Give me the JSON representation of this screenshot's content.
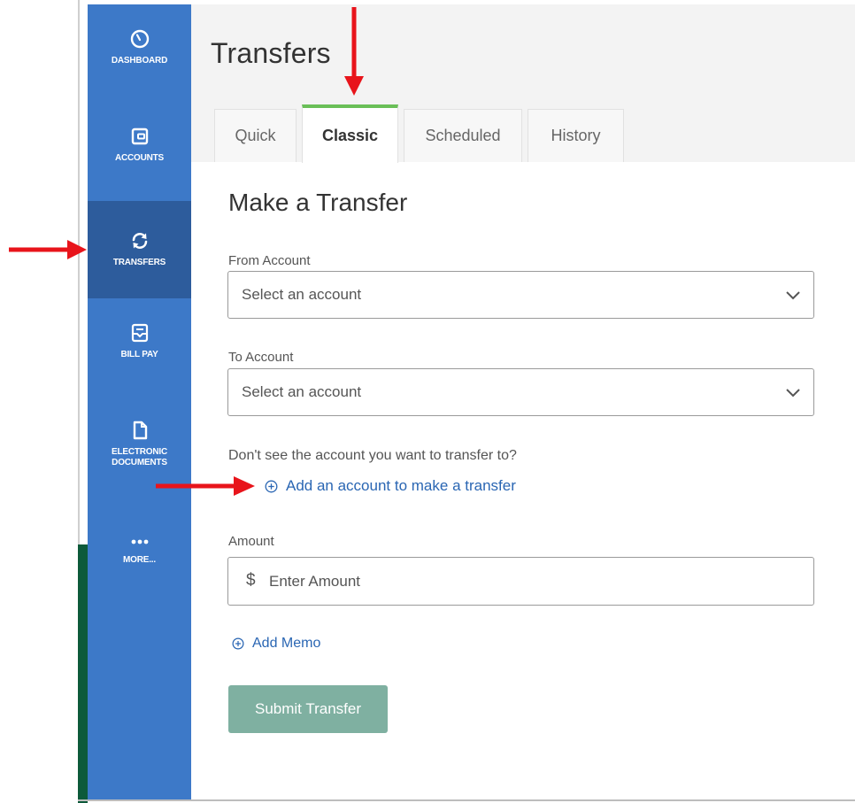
{
  "sidebar": {
    "items": [
      {
        "label": "DASHBOARD",
        "icon": "gauge-icon"
      },
      {
        "label": "ACCOUNTS",
        "icon": "wallet-icon"
      },
      {
        "label": "TRANSFERS",
        "icon": "sync-icon"
      },
      {
        "label": "BILL PAY",
        "icon": "inbox-icon"
      },
      {
        "label": "ELECTRONIC DOCUMENTS",
        "icon": "document-icon"
      },
      {
        "label": "MORE...",
        "icon": "more-dots-icon"
      }
    ],
    "active": "TRANSFERS"
  },
  "header": {
    "title": "Transfers",
    "tabs": [
      {
        "label": "Quick"
      },
      {
        "label": "Classic"
      },
      {
        "label": "Scheduled"
      },
      {
        "label": "History"
      }
    ],
    "active_tab": "Classic"
  },
  "form": {
    "title": "Make a Transfer",
    "from_label": "From Account",
    "from_value": "Select an account",
    "to_label": "To Account",
    "to_value": "Select an account",
    "hint": "Don't see the account you want to transfer to?",
    "add_account_link": "Add an account to make a transfer",
    "amount_label": "Amount",
    "currency_symbol": "$",
    "amount_placeholder": "Enter Amount",
    "add_memo_link": "Add Memo",
    "submit_label": "Submit Transfer"
  },
  "colors": {
    "sidebar": "#3d79c8",
    "sidebar_active": "#2d5c9c",
    "link": "#2a66b3",
    "active_tab_accent": "#6abf58",
    "submit_button": "#7fb0a1",
    "annotation_arrow": "#e8141b"
  }
}
